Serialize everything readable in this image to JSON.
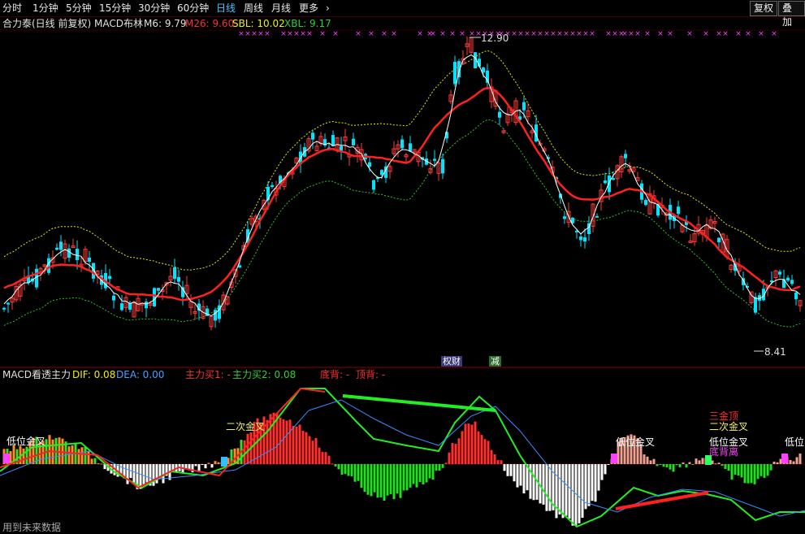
{
  "toolbar": {
    "tabs": [
      {
        "label": "分时",
        "active": false
      },
      {
        "label": "1分钟",
        "active": false
      },
      {
        "label": "5分钟",
        "active": false
      },
      {
        "label": "15分钟",
        "active": false
      },
      {
        "label": "30分钟",
        "active": false
      },
      {
        "label": "60分钟",
        "active": false
      },
      {
        "label": "日线",
        "active": true
      },
      {
        "label": "周线",
        "active": false
      },
      {
        "label": "月线",
        "active": false
      },
      {
        "label": "更多",
        "active": false
      }
    ],
    "more_arrow": "›",
    "restore_label": "复权",
    "overlay_label": "叠加"
  },
  "main_panel": {
    "title": "合力泰(日线 前复权) MACD布林",
    "m6_label": "M6: 9.79",
    "m26_label": "M26: 9.60",
    "sbl_label": "SBL: 10.02",
    "xbl_label": "XBL: 9.17",
    "high_marker": "12.90",
    "low_marker": "8.41",
    "badge_1": "权财",
    "badge_2": "减",
    "colors": {
      "up": "#ff3c3c",
      "down": "#00e5ff",
      "ma_red": "#ff2020",
      "upper_band": "#e6e600",
      "lower_band": "#2fbf2f",
      "mid_white": "#ffffff",
      "cross": "#ff40ff"
    }
  },
  "macd_panel": {
    "title": "MACD看透主力",
    "dif_label": "DIF: 0.08",
    "dea_label": "DEA: 0.00",
    "zl1_label": "主力买1: -",
    "zl2_label": "主力买2: 0.08",
    "bottom_div_label": "底背: -",
    "top_div_label": "顶背: -",
    "annotations": [
      "低位金叉",
      "二次金叉",
      "低位金叉",
      "三金顶",
      "二次金叉",
      "低位金叉",
      "底背离",
      "低位"
    ],
    "footer": "用到未来数据"
  }
}
